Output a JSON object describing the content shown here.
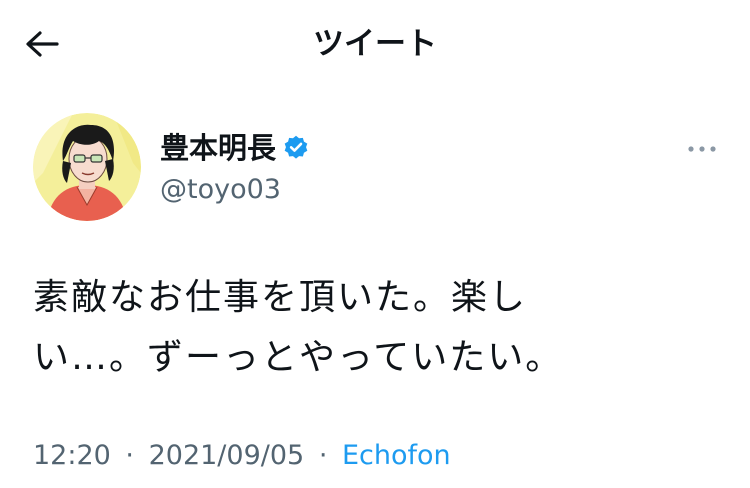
{
  "header": {
    "title": "ツイート",
    "back_icon": "arrow-left-icon"
  },
  "author": {
    "display_name": "豊本明長",
    "handle": "@toyo03",
    "verified_icon": "verified-badge-icon",
    "verified_color": "#1d9bf0"
  },
  "tweet": {
    "lines": [
      "素敵なお仕事を頂いた。楽し",
      "い…。ずーっとやっていたい。"
    ]
  },
  "meta": {
    "time": "12:20",
    "separator": "·",
    "date": "2021/09/05",
    "source": "Echofon"
  },
  "colors": {
    "text": "#0f1419",
    "secondary": "#536471",
    "link": "#1d9bf0",
    "background": "#ffffff"
  }
}
